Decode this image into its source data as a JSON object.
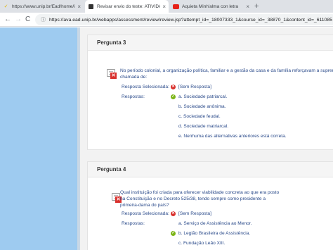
{
  "browser": {
    "tabs": [
      {
        "title": "https://www.unip.br/Ead/home/ind",
        "icon": "check-favicon"
      },
      {
        "title": "Revisar envio do teste: ATIVIDADE",
        "icon": "page-favicon"
      },
      {
        "title": "Aquieta Minh'alma con letra",
        "icon": "youtube-favicon"
      }
    ],
    "new_tab": "+",
    "close_glyph": "×",
    "back": "←",
    "forward": "→",
    "reload": "C",
    "info_icon": "ⓘ",
    "url": "https://ava.ead.unip.br/webapps/assessment/review/review.jsp?attempt_id=_18007333_1&course_id=_38870_1&content_id=_611085"
  },
  "questions": [
    {
      "heading": "Pergunta 3",
      "text_lines": [
        "No período colonial, a organização política, familiar e a gestão da casa e da família reforçavam a supremacia",
        "chamada de:"
      ],
      "selected_label": "Resposta Selecionada:",
      "selected_value": "[Sem Resposta]",
      "answers_label": "Respostas:",
      "options": [
        {
          "text": "a. Sociedade patriarcal.",
          "correct": true
        },
        {
          "text": "b. Sociedade anônima.",
          "correct": false
        },
        {
          "text": "c. Sociedade feudal.",
          "correct": false
        },
        {
          "text": "d. Sociedade matriarcal.",
          "correct": false
        },
        {
          "text": "e. Nenhuma das alternativas anteriores está correta.",
          "correct": false
        }
      ]
    },
    {
      "heading": "Pergunta 4",
      "text_lines": [
        "Qual instituição foi criada para oferecer viabilidade concreta ao que era posto",
        "na Constituição e no Decreto 525/38, tendo sempre como presidente a",
        "primeira-dama do país?"
      ],
      "selected_label": "Resposta Selecionada:",
      "selected_value": "[Sem Resposta]",
      "answers_label": "Respostas:",
      "options": [
        {
          "text": "a. Serviço de Assistência ao Menor.",
          "correct": false
        },
        {
          "text": "b. Legião Brasileira de Assistência.",
          "correct": true
        },
        {
          "text": "c. Fundação Leão XIII.",
          "correct": false
        }
      ]
    }
  ],
  "colors": {
    "sidebar": "#9ecbf0",
    "link_text": "#2a4a8a",
    "wrong": "#d9302c",
    "correct": "#7cb518"
  }
}
